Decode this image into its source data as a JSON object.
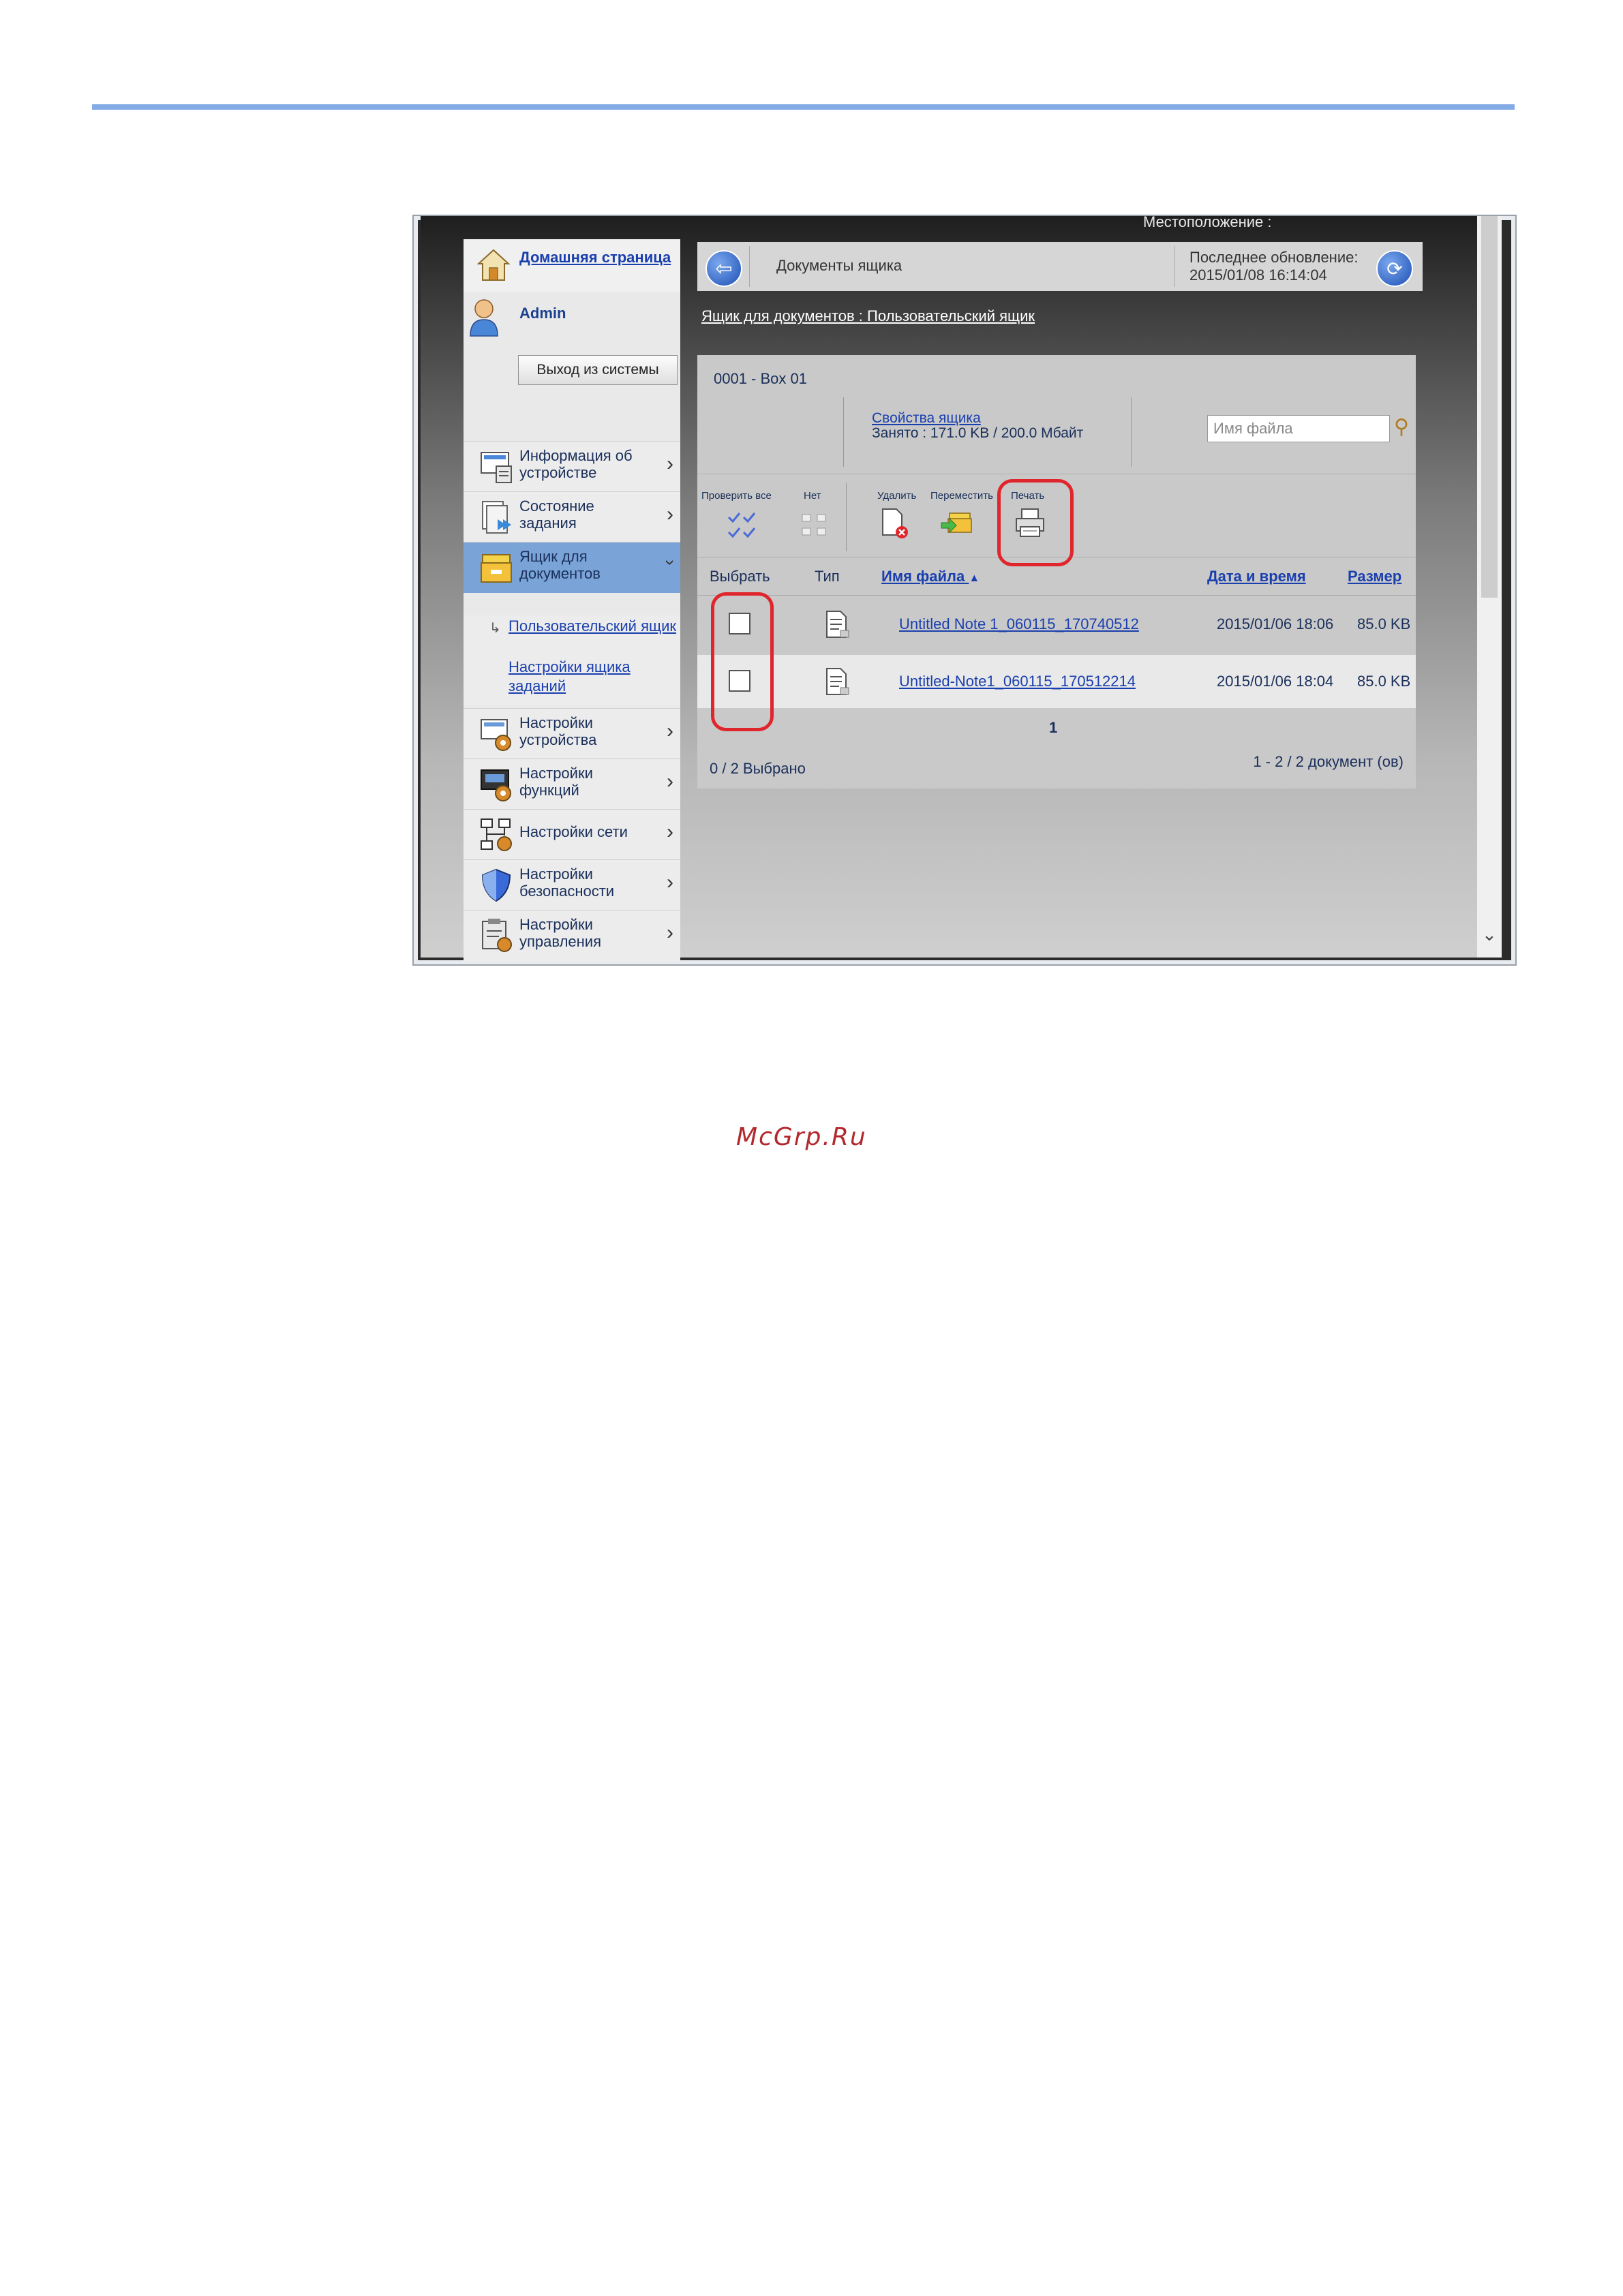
{
  "location_label": "Местоположение :",
  "nav": {
    "home": "Домашняя страница",
    "user": "Admin",
    "logout": "Выход из системы",
    "items": [
      {
        "label": "Информация об устройстве"
      },
      {
        "label": "Состояние задания"
      },
      {
        "label": "Ящик для документов"
      },
      {
        "label": "Настройки устройства"
      },
      {
        "label": "Настройки функций"
      },
      {
        "label": "Настройки сети"
      },
      {
        "label": "Настройки безопасности"
      },
      {
        "label": "Настройки управления"
      }
    ],
    "sub": [
      "Пользовательский ящик",
      "Настройки ящика заданий"
    ]
  },
  "header": {
    "title": "Документы ящика",
    "last_update_label": "Последнее обновление:",
    "last_update_value": "2015/01/08 16:14:04"
  },
  "breadcrumb": "Ящик для документов : Пользовательский ящик",
  "box": {
    "name": "0001 - Box 01",
    "properties_link": "Свойства ящика",
    "usage": "Занято : 171.0 KB / 200.0 Мбайт",
    "search_placeholder": "Имя файла"
  },
  "toolbar": {
    "check_all": "Проверить все",
    "none": "Нет",
    "delete": "Удалить",
    "move": "Переместить",
    "print": "Печать"
  },
  "columns": {
    "select": "Выбрать",
    "type": "Тип",
    "filename": "Имя файла",
    "datetime": "Дата и время",
    "size": "Размер"
  },
  "rows": [
    {
      "filename": "Untitled Note 1_060115_170740512",
      "datetime": "2015/01/06 18:06",
      "size": "85.0 KB"
    },
    {
      "filename": "Untitled-Note1_060115_170512214",
      "datetime": "2015/01/06 18:04",
      "size": "85.0 KB"
    }
  ],
  "pager": {
    "page": "1"
  },
  "footer": {
    "selected": "0 / 2 Выбрано",
    "count": "1 - 2 / 2 документ (ов)"
  },
  "watermark": "McGrp.Ru"
}
